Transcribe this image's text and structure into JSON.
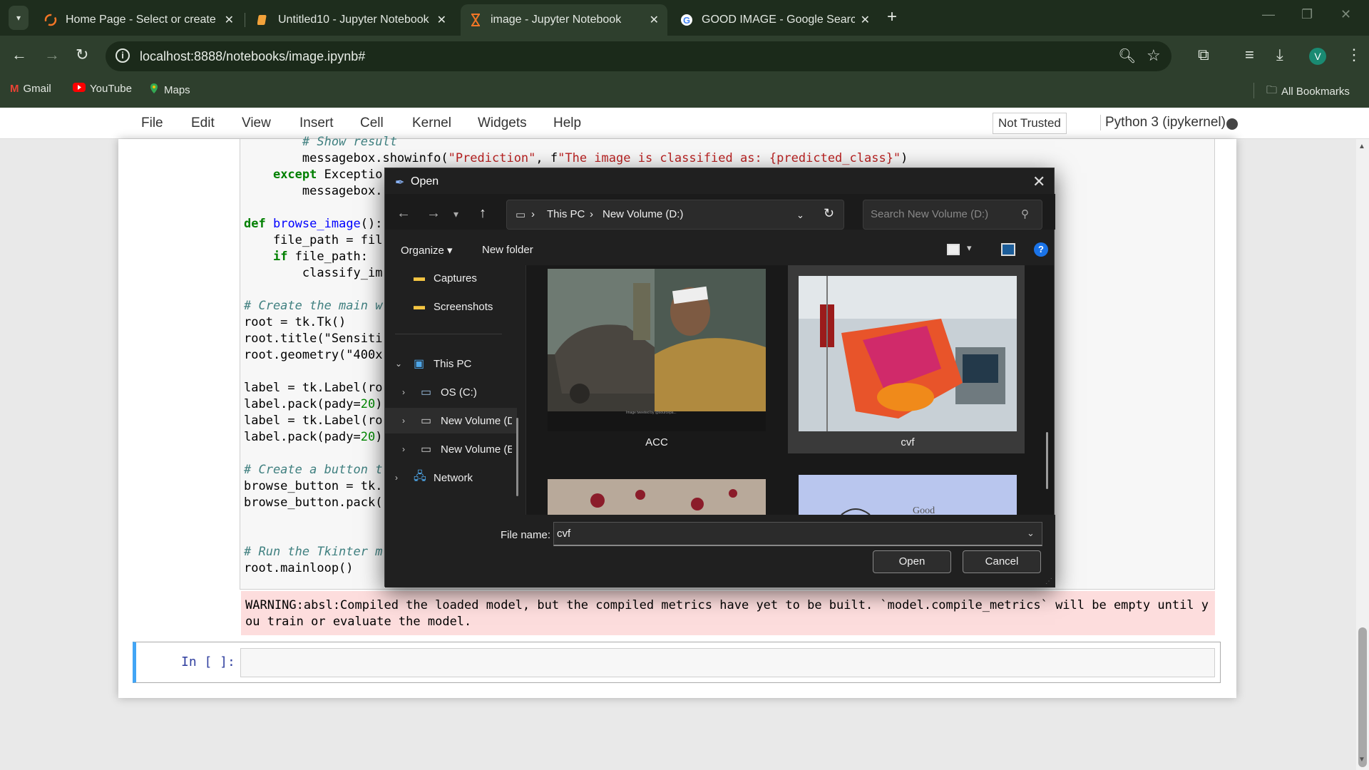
{
  "browser": {
    "tabs": [
      {
        "title": "Home Page - Select or create a",
        "icon": "jupyter-icon"
      },
      {
        "title": "Untitled10 - Jupyter Notebook",
        "icon": "notebook-icon"
      },
      {
        "title": "image - Jupyter Notebook",
        "icon": "hourglass-icon"
      },
      {
        "title": "GOOD IMAGE - Google Search",
        "icon": "google-icon"
      }
    ],
    "url": "localhost:8888/notebooks/image.ipynb#",
    "avatar": "V",
    "bookmarks": [
      {
        "label": "Gmail"
      },
      {
        "label": "YouTube"
      },
      {
        "label": "Maps"
      }
    ],
    "all_bookmarks": "All Bookmarks"
  },
  "jupyter": {
    "menu": [
      "File",
      "Edit",
      "View",
      "Insert",
      "Cell",
      "Kernel",
      "Widgets",
      "Help"
    ],
    "trusted": "Not Trusted",
    "kernel": "Python 3 (ipykernel)",
    "code_lines": [
      "        # Show result",
      "        messagebox.showinfo(\"Prediction\", f\"The image is classified as: {predicted_class}\")",
      "    except Exceptio",
      "        messagebox.",
      "",
      "def browse_image():",
      "    file_path = fil",
      "    if file_path:",
      "        classify_im",
      "",
      "# Create the main w",
      "root = tk.Tk()",
      "root.title(\"Sensiti",
      "root.geometry(\"400x",
      "",
      "label = tk.Label(ro",
      "label.pack(pady=20)",
      "label = tk.Label(ro",
      "label.pack(pady=20)",
      "",
      "# Create a button t",
      "browse_button = tk.",
      "browse_button.pack(",
      "",
      "",
      "# Run the Tkinter m",
      "root.mainloop()"
    ],
    "warning": "WARNING:absl:Compiled the loaded model, but the compiled metrics have yet to be built. `model.compile_metrics` will be empty until you train or evaluate the model.",
    "prompt": "In [ ]:"
  },
  "dialog": {
    "title": "Open",
    "breadcrumb": [
      "This PC",
      "New Volume (D:)"
    ],
    "search_placeholder": "Search New Volume (D:)",
    "organize": "Organize",
    "new_folder": "New folder",
    "nav": [
      {
        "label": "Captures",
        "icon": "folder-icon"
      },
      {
        "label": "Screenshots",
        "icon": "folder-icon"
      },
      {
        "label": "This PC",
        "icon": "computer-icon"
      },
      {
        "label": "OS (C:)",
        "icon": "drive-icon"
      },
      {
        "label": "New Volume (D:)",
        "icon": "drive-icon"
      },
      {
        "label": "New Volume (E:)",
        "icon": "drive-icon"
      },
      {
        "label": "Network",
        "icon": "network-icon"
      }
    ],
    "files": [
      {
        "name": "ACC"
      },
      {
        "name": "cvf"
      }
    ],
    "thumb_text": "Good",
    "thumb_caption": "Image tweeted by @sourcepa...",
    "filename_label": "File name:",
    "filename": "cvf",
    "open": "Open",
    "cancel": "Cancel"
  }
}
